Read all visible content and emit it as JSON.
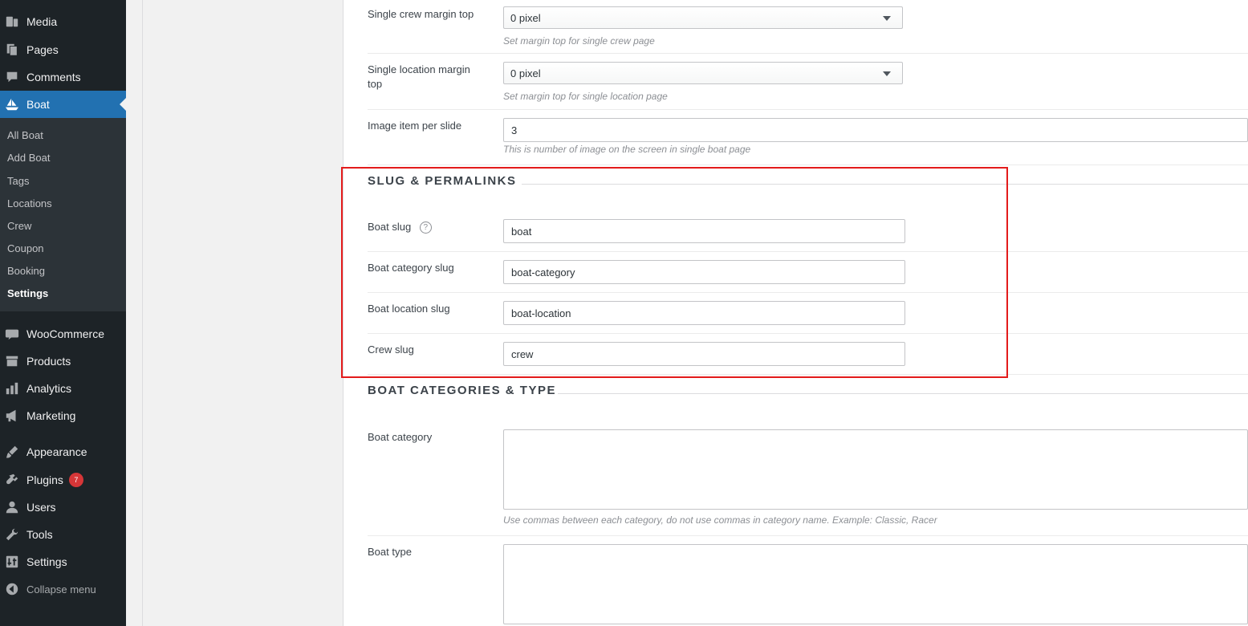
{
  "sidebar": {
    "menu": [
      {
        "key": "media",
        "label": "Media",
        "icon": "media-icon"
      },
      {
        "key": "pages",
        "label": "Pages",
        "icon": "pages-icon"
      },
      {
        "key": "comments",
        "label": "Comments",
        "icon": "comments-icon"
      },
      {
        "key": "boat",
        "label": "Boat",
        "icon": "boat-icon",
        "current": true
      },
      {
        "key": "woocommerce",
        "label": "WooCommerce",
        "icon": "woocommerce-icon"
      },
      {
        "key": "products",
        "label": "Products",
        "icon": "products-icon"
      },
      {
        "key": "analytics",
        "label": "Analytics",
        "icon": "analytics-icon"
      },
      {
        "key": "marketing",
        "label": "Marketing",
        "icon": "marketing-icon"
      },
      {
        "key": "appearance",
        "label": "Appearance",
        "icon": "appearance-icon"
      },
      {
        "key": "plugins",
        "label": "Plugins",
        "icon": "plugins-icon",
        "badge": "7"
      },
      {
        "key": "users",
        "label": "Users",
        "icon": "users-icon"
      },
      {
        "key": "tools",
        "label": "Tools",
        "icon": "tools-icon"
      },
      {
        "key": "settings",
        "label": "Settings",
        "icon": "settings-icon"
      }
    ],
    "submenu": [
      "All Boat",
      "Add Boat",
      "Tags",
      "Locations",
      "Crew",
      "Coupon",
      "Booking",
      "Settings"
    ],
    "submenu_active": "Settings",
    "collapse_label": "Collapse menu"
  },
  "settings": {
    "crew_margin": {
      "label": "Single crew margin top",
      "value": "0 pixel",
      "description": "Set margin top for single crew page"
    },
    "location_margin": {
      "label_line1": "Single location margin",
      "label_line2": "top",
      "value": "0 pixel",
      "description": "Set margin top for single location page"
    },
    "image_per_slide": {
      "label": "Image item per slide",
      "value": "3",
      "description": "This is number of image on the screen in single boat page"
    },
    "slug_section": {
      "title": "SLUG & PERMALINKS",
      "boat_slug": {
        "label": "Boat slug",
        "help": "?",
        "value": "boat"
      },
      "category_slug": {
        "label": "Boat category slug",
        "value": "boat-category"
      },
      "location_slug": {
        "label": "Boat location slug",
        "value": "boat-location"
      },
      "crew_slug": {
        "label": "Crew slug",
        "value": "crew"
      }
    },
    "categories_section": {
      "title": "BOAT CATEGORIES & TYPE",
      "boat_category": {
        "label": "Boat category",
        "value": "",
        "description": "Use commas between each category, do not use commas in category name. Example: Classic, Racer"
      },
      "boat_type": {
        "label": "Boat type",
        "value": ""
      }
    }
  },
  "colors": {
    "sidebar_bg": "#1d2327",
    "submenu_bg": "#2c3338",
    "current_menu": "#2271b1",
    "highlight_box": "#e31b1b",
    "badge": "#d63638"
  }
}
